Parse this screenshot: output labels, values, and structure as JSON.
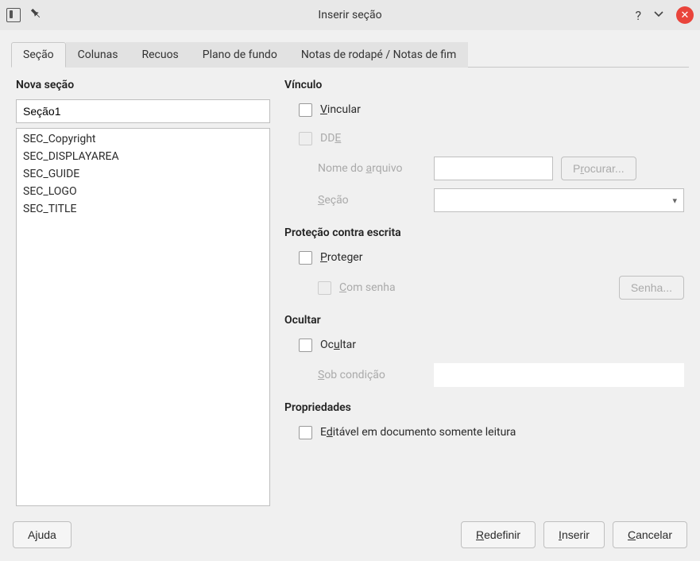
{
  "window": {
    "title": "Inserir seção"
  },
  "tabs": {
    "sec": "Seção",
    "columns": "Colunas",
    "indents": "Recuos",
    "background": "Plano de fundo",
    "notes": "Notas de rodapé / Notas de fim"
  },
  "newSection": {
    "label": "Nova seção",
    "value": "Seção1",
    "items": [
      "SEC_Copyright",
      "SEC_DISPLAYAREA",
      "SEC_GUIDE",
      "SEC_LOGO",
      "SEC_TITLE"
    ]
  },
  "link": {
    "group": "Vínculo",
    "vincular_pre": "V",
    "vincular_post": "incular",
    "dde_pre": "DD",
    "dde_under": "E",
    "fileLabel_pre": "Nome do ",
    "fileLabel_under": "a",
    "fileLabel_post": "rquivo",
    "browse_pre": "P",
    "browse_under": "r",
    "browse_post": "ocurar...",
    "section_under": "S",
    "section_post": "eção"
  },
  "protect": {
    "group": "Proteção contra escrita",
    "protect_under": "P",
    "protect_post": "roteger",
    "withPass_under": "C",
    "withPass_post": "om senha",
    "passwordBtn": "Senha..."
  },
  "hide": {
    "group": "Ocultar",
    "hide_pre": "Oc",
    "hide_under": "u",
    "hide_post": "ltar",
    "cond_under": "S",
    "cond_post": "ob condição"
  },
  "props": {
    "group": "Propriedades",
    "editable_pre": "E",
    "editable_under": "d",
    "editable_post": "itável em documento somente leitura"
  },
  "footer": {
    "help_pre": "A",
    "help_under": "j",
    "help_post": "uda",
    "reset_under": "R",
    "reset_post": "edefinir",
    "insert_under": "I",
    "insert_post": "nserir",
    "cancel_under": "C",
    "cancel_post": "ancelar"
  }
}
